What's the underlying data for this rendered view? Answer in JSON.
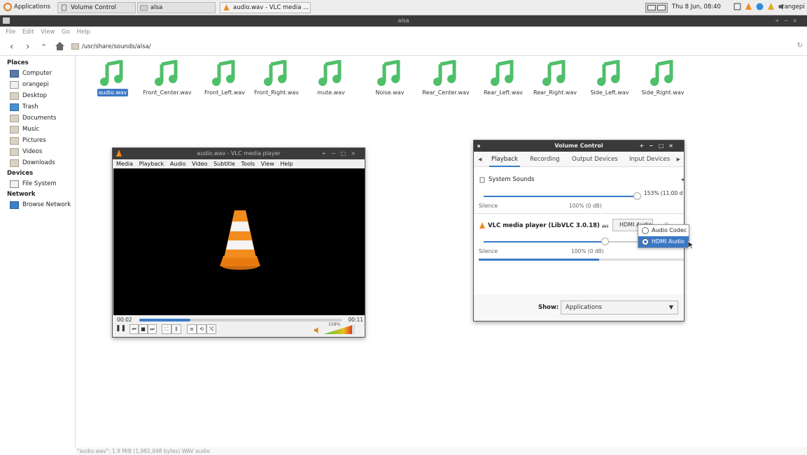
{
  "taskbar": {
    "apps_label": "Applications",
    "tasks": [
      "Volume Control",
      "alsa",
      "audio.wav - VLC media ..."
    ],
    "clock": "Thu  8 Jun, 08:40",
    "user": "orangepi"
  },
  "caja": {
    "title": "alsa",
    "menu": [
      "File",
      "Edit",
      "View",
      "Go",
      "Help"
    ],
    "path": "/usr/share/sounds/alsa/",
    "places_header": "Places",
    "places": [
      "Computer",
      "orangepi",
      "Desktop",
      "Trash",
      "Documents",
      "Music",
      "Pictures",
      "Videos",
      "Downloads"
    ],
    "devices_header": "Devices",
    "devices": [
      "File System"
    ],
    "network_header": "Network",
    "network": [
      "Browse Network"
    ],
    "files": [
      "audio.wav",
      "Front_Center.wav",
      "Front_Left.wav",
      "Front_Right.wav",
      "mute.wav",
      "Noise.wav",
      "Rear_Center.wav",
      "Rear_Left.wav",
      "Rear_Right.wav",
      "Side_Left.wav",
      "Side_Right.wav"
    ],
    "selected_file": "audio.wav",
    "status": "\"audio.wav\": 1.9 MiB (1,982,048 bytes) WAV audio",
    "accent": "#3a78c6",
    "icon_color": "#4fbf6a"
  },
  "vlc": {
    "title": "audio.wav - VLC media player",
    "menu": [
      "Media",
      "Playback",
      "Audio",
      "Video",
      "Subtitle",
      "Tools",
      "View",
      "Help"
    ],
    "elapsed": "00:02",
    "total": "00:11",
    "progress": 0.25,
    "volume_pct": "159%"
  },
  "volume_control": {
    "title": "Volume Control",
    "tabs": [
      "Playback",
      "Recording",
      "Output Devices",
      "Input Devices"
    ],
    "active_tab": "Playback",
    "system_sounds": {
      "label": "System Sounds",
      "value": "153% (11.00 d",
      "silence": "Silence",
      "mark": "100% (0 dB)"
    },
    "stream": {
      "app": "VLC media player (LibVLC 3.0.18) ...",
      "on": "on",
      "device": "HDMI Audio",
      "silence": "Silence",
      "mark": "100% (0 dB)"
    },
    "show_label": "Show:",
    "show_value": "Applications"
  },
  "device_popup": {
    "options": [
      "Audio Codec",
      "HDMI Audio"
    ],
    "selected": "HDMI Audio"
  }
}
